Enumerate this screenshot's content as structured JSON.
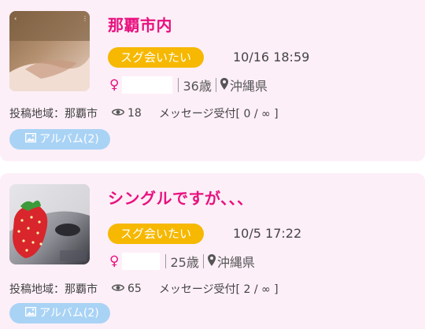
{
  "posts": [
    {
      "title": "那覇市内",
      "tag": "スグ会いたい",
      "time": "10/16 18:59",
      "sex_symbol": "♀",
      "age": "36歳",
      "location": "沖縄県",
      "area": "投稿地域：那覇市",
      "views": "18",
      "message": "メッセージ受付[ 0 / ∞ ]",
      "album": "アルバム(2)"
    },
    {
      "title": "シングルですが、、、",
      "tag": "スグ会いたい",
      "time": "10/5 17:22",
      "sex_symbol": "♀",
      "age": "25歳",
      "location": "沖縄県",
      "area": "投稿地域：那覇市",
      "views": "65",
      "message": "メッセージ受付[ 2 / ∞ ]",
      "album": "アルバム(2)"
    }
  ],
  "colors": {
    "card_bg": "#fdeff8",
    "title": "#e8117e",
    "tag_bg": "#f6b800",
    "album_bg": "#a9d3f5"
  }
}
